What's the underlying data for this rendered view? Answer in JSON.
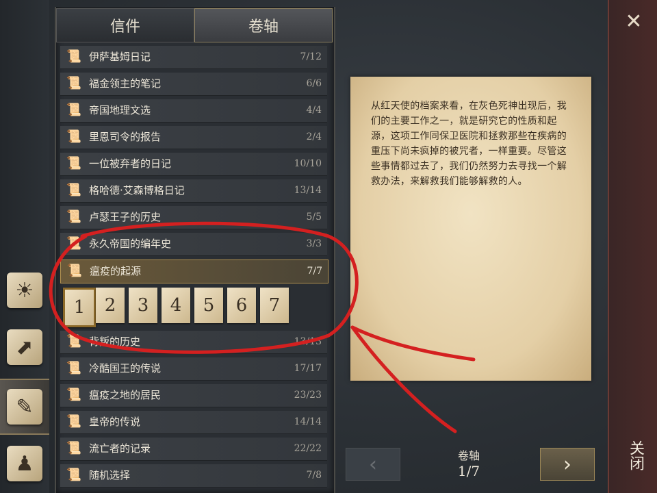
{
  "tabs": [
    {
      "label": "信件",
      "active": false
    },
    {
      "label": "卷轴",
      "active": true
    }
  ],
  "list_items": [
    {
      "label": "伊萨基姆日记",
      "count": "7/12"
    },
    {
      "label": "福金领主的笔记",
      "count": "6/6"
    },
    {
      "label": "帝国地理文选",
      "count": "4/4"
    },
    {
      "label": "里恩司令的报告",
      "count": "2/4"
    },
    {
      "label": "一位被弃者的日记",
      "count": "10/10"
    },
    {
      "label": "格哈德·艾森博格日记",
      "count": "13/14"
    },
    {
      "label": "卢瑟王子的历史",
      "count": "5/5"
    },
    {
      "label": "永久帝国的编年史",
      "count": "3/3"
    },
    {
      "label": "瘟疫的起源",
      "count": "7/7",
      "selected": true
    },
    {
      "label": "背叛的历史",
      "count": "13/13"
    },
    {
      "label": "冷酷国王的传说",
      "count": "17/17"
    },
    {
      "label": "瘟疫之地的居民",
      "count": "23/23"
    },
    {
      "label": "皇帝的传说",
      "count": "14/14"
    },
    {
      "label": "流亡者的记录",
      "count": "22/22"
    },
    {
      "label": "随机选择",
      "count": "7/8"
    }
  ],
  "pages": [
    "1",
    "2",
    "3",
    "4",
    "5",
    "6",
    "7"
  ],
  "current_page": "1",
  "document_text": "从红天使的档案来看，在灰色死神出现后，我们的主要工作之一，就是研究它的性质和起源，这项工作同保卫医院和拯救那些在疾病的重压下尚未疯掉的被咒者，一样重要。尽管这些事情都过去了，我们仍然努力去寻找一个解救办法，来解救我们能够解救的人。",
  "pager": {
    "label": "卷轴",
    "count": "1/7"
  },
  "close": {
    "label": "关闭"
  },
  "colors": {
    "accent": "#b39250",
    "annotation": "#d42020",
    "parchment": "#e8d5ae"
  }
}
